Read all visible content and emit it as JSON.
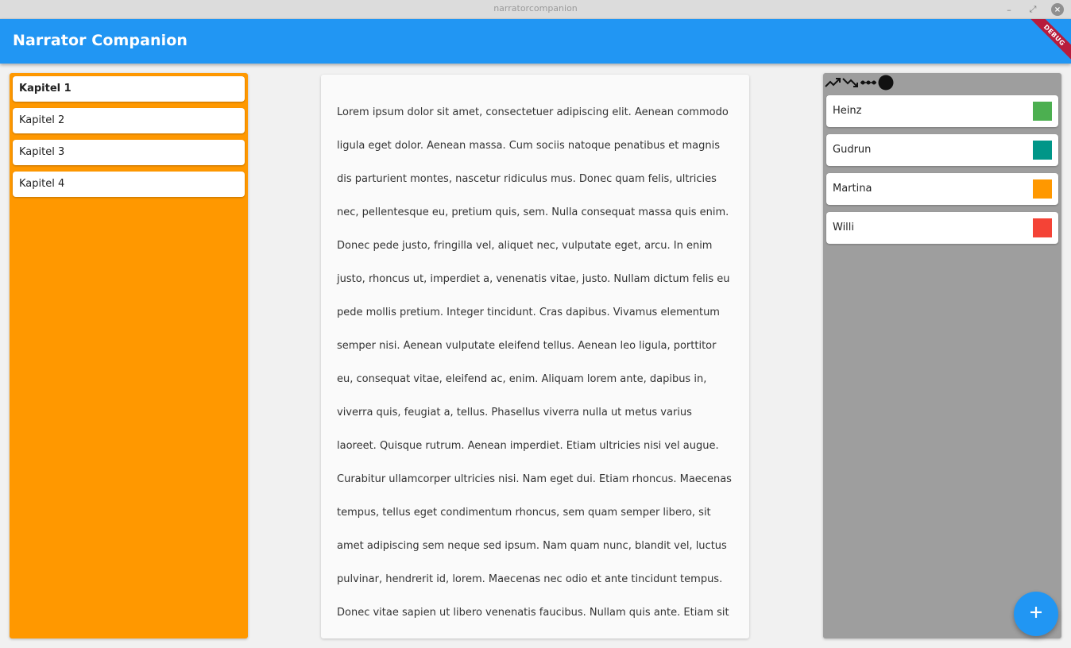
{
  "window": {
    "title": "narratorcompanion",
    "minimize_glyph": "–",
    "maximize_glyph": "⤢",
    "close_glyph": "×"
  },
  "appbar": {
    "title": "Narrator Companion",
    "color": "#2196f3",
    "debug_label": "DEBUG"
  },
  "chapters": {
    "panel_color": "#ff9800",
    "items": [
      {
        "label": "Kapitel 1",
        "active": true
      },
      {
        "label": "Kapitel 2",
        "active": false
      },
      {
        "label": "Kapitel 3",
        "active": false
      },
      {
        "label": "Kapitel 4",
        "active": false
      }
    ]
  },
  "text": {
    "body": "Lorem ipsum dolor sit amet, consectetuer adipiscing elit. Aenean commodo ligula eget dolor. Aenean massa. Cum sociis natoque penatibus et magnis dis parturient montes, nascetur ridiculus mus. Donec quam felis, ultricies nec, pellentesque eu, pretium quis, sem. Nulla consequat massa quis enim. Donec pede justo, fringilla vel, aliquet nec, vulputate eget, arcu. In enim justo, rhoncus ut, imperdiet a, venenatis vitae, justo. Nullam dictum felis eu pede mollis pretium. Integer tincidunt. Cras dapibus. Vivamus elementum semper nisi. Aenean vulputate eleifend tellus. Aenean leo ligula, porttitor eu, consequat vitae, eleifend ac, enim. Aliquam lorem ante, dapibus in, viverra quis, feugiat a, tellus. Phasellus viverra nulla ut metus varius laoreet. Quisque rutrum. Aenean imperdiet. Etiam ultricies nisi vel augue. Curabitur ullamcorper ultricies nisi. Nam eget dui. Etiam rhoncus. Maecenas tempus, tellus eget condimentum rhoncus, sem quam semper libero, sit amet adipiscing sem neque sed ipsum. Nam quam nunc, blandit vel, luctus pulvinar, hendrerit id, lorem. Maecenas nec odio et ante tincidunt tempus. Donec vitae sapien ut libero venenatis faucibus. Nullam quis ante. Etiam sit amet orci eget eros"
  },
  "characters": {
    "panel_color": "#9e9e9e",
    "toolbar": [
      "trend-up-icon",
      "trend-down-icon",
      "dotted-line-icon",
      "circle-icon"
    ],
    "items": [
      {
        "name": "Heinz",
        "color": "#4caf50"
      },
      {
        "name": "Gudrun",
        "color": "#009688"
      },
      {
        "name": "Martina",
        "color": "#ff9800"
      },
      {
        "name": "Willi",
        "color": "#f44336"
      }
    ]
  },
  "fab": {
    "icon": "plus-icon",
    "glyph": "+"
  }
}
